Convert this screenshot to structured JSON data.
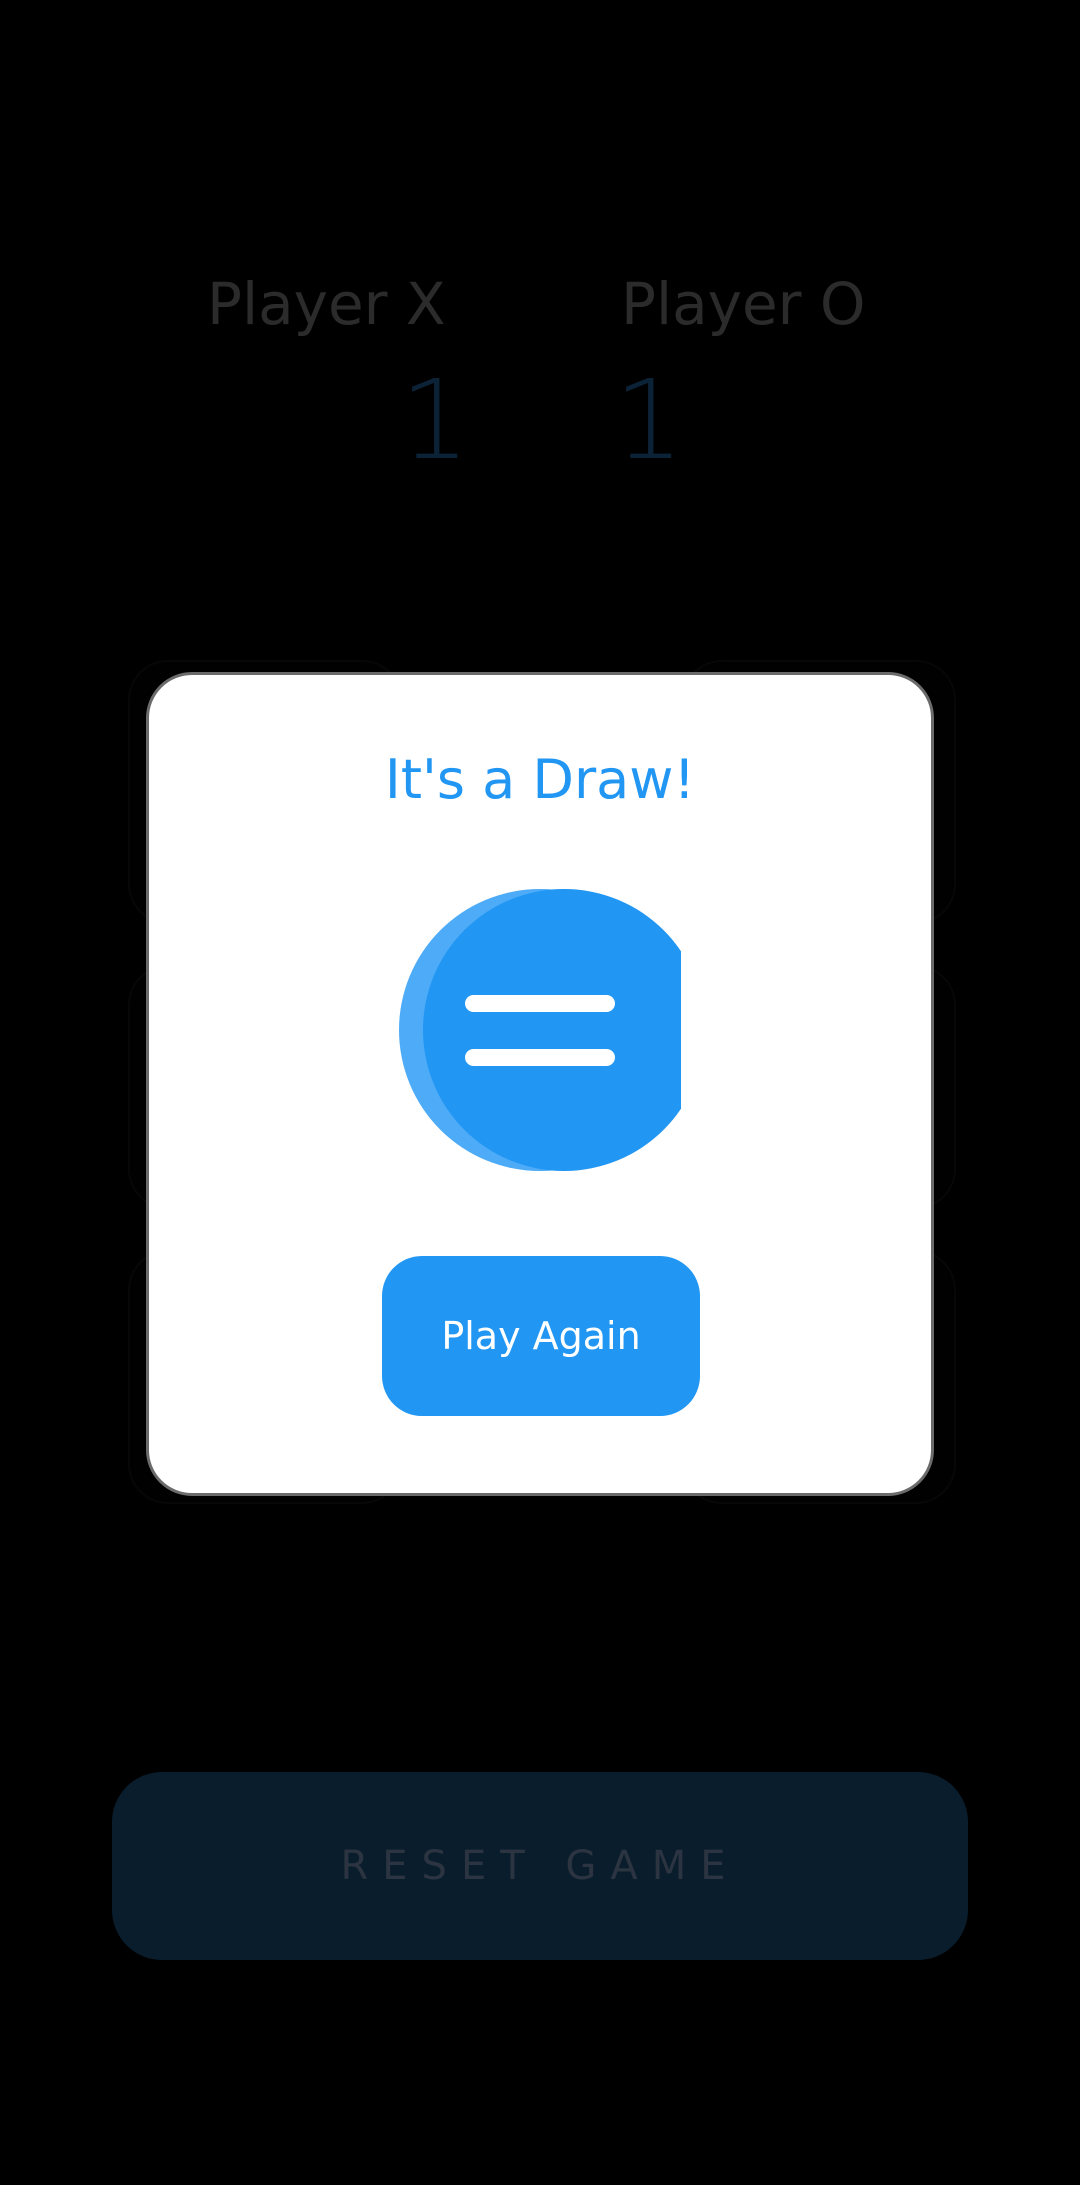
{
  "scoreboard": {
    "player_x_label": "Player X",
    "player_o_label": "Player O",
    "player_x_score": "1",
    "player_o_score": "1"
  },
  "modal": {
    "title": "It's a Draw!",
    "icon": "equals-icon",
    "play_again_label": "Play Again"
  },
  "reset_label": "RESET GAME",
  "colors": {
    "background": "#000000",
    "accent": "#2196f3",
    "accent_light": "#4dabf7",
    "reset_bg": "#0a1d2d",
    "score_value": "#0c2236",
    "score_label": "#2b2b2b"
  }
}
